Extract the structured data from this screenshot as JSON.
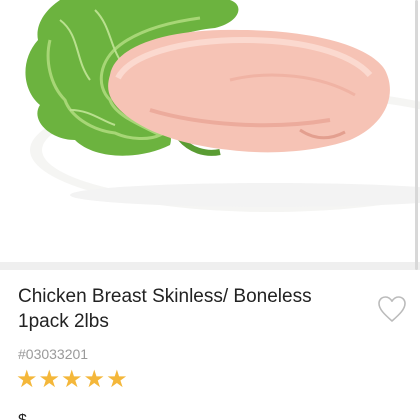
{
  "product": {
    "image_alt": "Raw chicken breast on lettuce",
    "title": "Chicken Breast Skinless/ Boneless 1pack 2lbs",
    "sku": "#03033201",
    "rating": 5,
    "stars": [
      "★",
      "★",
      "★",
      "★",
      "★"
    ],
    "favorite_icon": "heart-outline-icon",
    "price_partial": "$"
  },
  "colors": {
    "star": "#f4b73a",
    "favorite": "#bbbbbb",
    "text": "#222222",
    "sku": "#9a9a9a"
  }
}
